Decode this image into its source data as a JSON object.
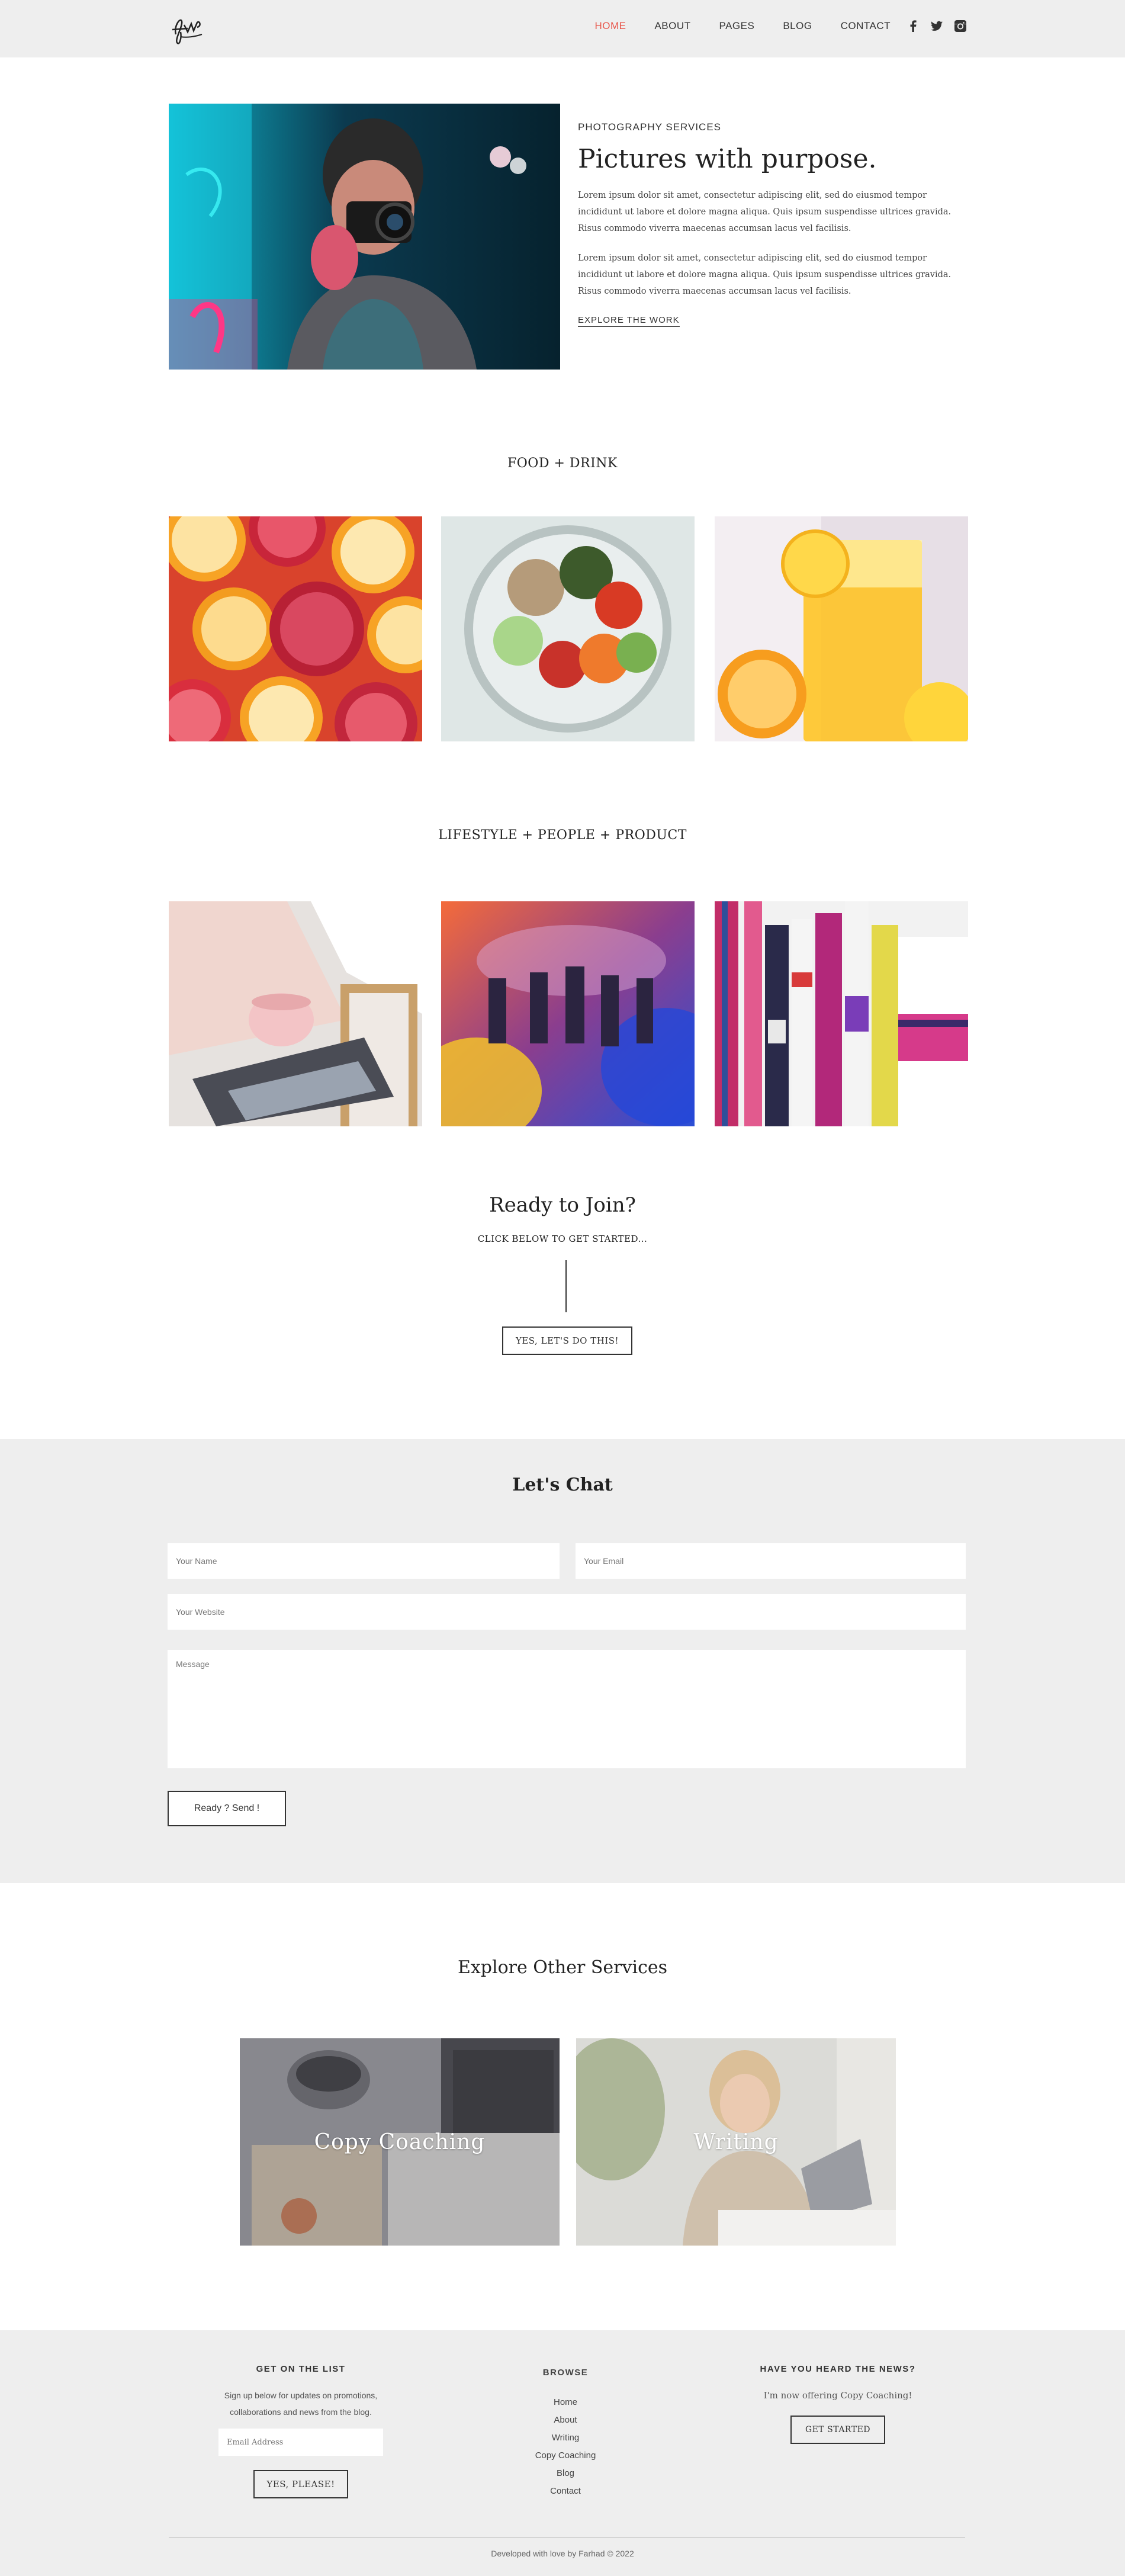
{
  "colors": {
    "accent": "#e8574c",
    "header_bg": "#eeeeee",
    "section_bg": "#eeeeee",
    "text": "#222222"
  },
  "header": {
    "nav": [
      "HOME",
      "ABOUT",
      "PAGES",
      "BLOG",
      "CONTACT"
    ],
    "active": "HOME",
    "socials": [
      "facebook-icon",
      "twitter-icon",
      "instagram-icon"
    ]
  },
  "hero": {
    "eyebrow": "PHOTOGRAPHY SERVICES",
    "title": "Pictures with purpose.",
    "paragraph1": "Lorem ipsum dolor sit amet, consectetur adipiscing elit, sed do eiusmod tempor incididunt ut labore et dolore magna aliqua. Quis ipsum suspendisse ultrices gravida. Risus commodo viverra maecenas accumsan lacus vel facilisis.",
    "paragraph2": "Lorem ipsum dolor sit amet, consectetur adipiscing elit, sed do eiusmod tempor incididunt ut labore et dolore magna aliqua. Quis ipsum suspendisse ultrices gravida. Risus commodo viverra maecenas accumsan lacus vel facilisis.",
    "link": "EXPLORE THE WORK"
  },
  "food": {
    "title": "FOOD + DRINK"
  },
  "lifestyle": {
    "title": "LIFESTYLE + PEOPLE + PRODUCT"
  },
  "cta": {
    "title": "Ready to Join?",
    "subtitle": "CLICK BELOW TO GET STARTED...",
    "button": "YES, LET'S DO THIS!"
  },
  "chat": {
    "title": "Let's Chat",
    "name_placeholder": "Your Name",
    "email_placeholder": "Your Email",
    "website_placeholder": "Your Website",
    "message_placeholder": "Message",
    "send": "Ready ? Send !"
  },
  "explore": {
    "title": "Explore Other Services",
    "services": [
      "Copy Coaching",
      "Writing"
    ]
  },
  "footer": {
    "list_head": "GET ON THE LIST",
    "list_text_1": "Sign up below for updates on promotions,",
    "list_text_2": "collaborations and news from the blog.",
    "email_placeholder": "Email Address",
    "list_button": "YES, PLEASE!",
    "browse_head": "BROWSE",
    "browse_links": [
      "Home",
      "About",
      "Writing",
      "Copy Coaching",
      "Blog",
      "Contact"
    ],
    "news_head": "HAVE YOU HEARD THE NEWS?",
    "news_text": "I'm now offering Copy Coaching!",
    "news_button": "GET STARTED",
    "copyright": "Developed with love by Farhad © 2022"
  }
}
